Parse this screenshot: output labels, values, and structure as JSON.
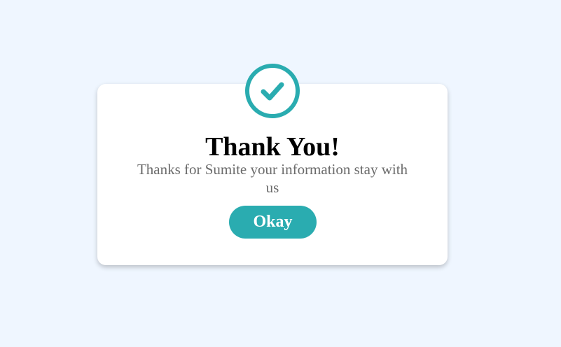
{
  "dialog": {
    "icon": "check-circle-icon",
    "title": "Thank You!",
    "message": "Thanks for Sumite your information stay with us",
    "button_label": "Okay"
  },
  "colors": {
    "background": "#eff6ff",
    "card": "#ffffff",
    "accent": "#2aacb0",
    "title_text": "#000000",
    "message_text": "#6b6b6b"
  }
}
